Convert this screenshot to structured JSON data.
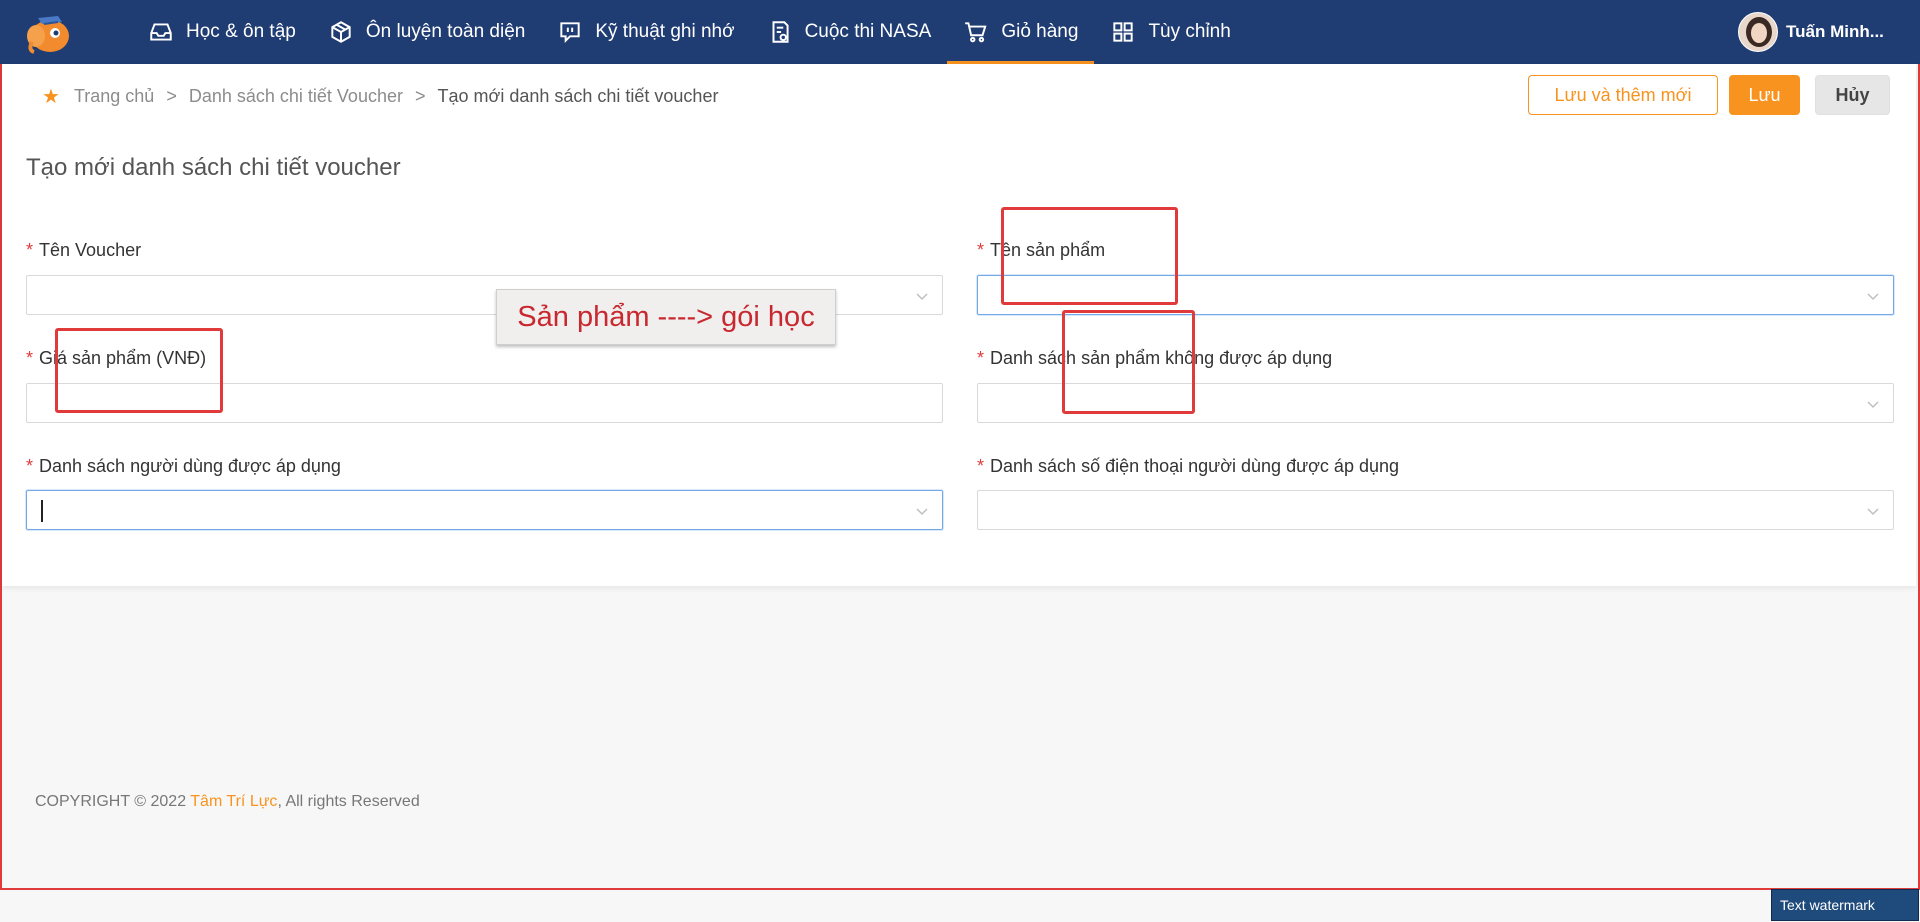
{
  "nav": {
    "items": [
      {
        "label": "Học & ôn tập",
        "icon": "inbox-icon"
      },
      {
        "label": "Ôn luyện toàn diện",
        "icon": "cube-icon"
      },
      {
        "label": "Kỹ thuật ghi nhớ",
        "icon": "chat-icon"
      },
      {
        "label": "Cuộc thi NASA",
        "icon": "document-icon"
      },
      {
        "label": "Giỏ hàng",
        "icon": "cart-icon",
        "active": true
      },
      {
        "label": "Tùy chỉnh",
        "icon": "grid-icon"
      }
    ],
    "user_name": "Tuấn Minh..."
  },
  "breadcrumb": {
    "items": [
      "Trang chủ",
      "Danh sách chi tiết Voucher",
      "Tạo mới danh sách chi tiết voucher"
    ],
    "separator": ">"
  },
  "actions": {
    "save_new": "Lưu và thêm mới",
    "save": "Lưu",
    "cancel": "Hủy"
  },
  "form": {
    "title": "Tạo mới danh sách chi tiết voucher",
    "required_mark": "*",
    "fields": {
      "voucher_name": {
        "label": "Tên Voucher",
        "value": ""
      },
      "product_name": {
        "label": "Tên sản phẩm",
        "value": ""
      },
      "product_price": {
        "label": "Giá sản phẩm (VNĐ)",
        "value": ""
      },
      "excluded_products": {
        "label": "Danh sách sản phẩm không được áp dụng",
        "value": ""
      },
      "applied_users": {
        "label": "Danh sách người dùng được áp dụng",
        "value": ""
      },
      "applied_phones": {
        "label": "Danh sách số điện thoại người dùng được áp dụng",
        "value": ""
      }
    }
  },
  "annotation": {
    "callout": "Sản phẩm ----> gói học"
  },
  "footer": {
    "prefix": "COPYRIGHT © 2022 ",
    "brand": "Tâm Trí Lực",
    "suffix": ", All rights Reserved"
  },
  "watermark": "Text watermark",
  "colors": {
    "nav_bg": "#1f3c73",
    "accent": "#f7931e",
    "annotation_red": "#e03a3a"
  }
}
